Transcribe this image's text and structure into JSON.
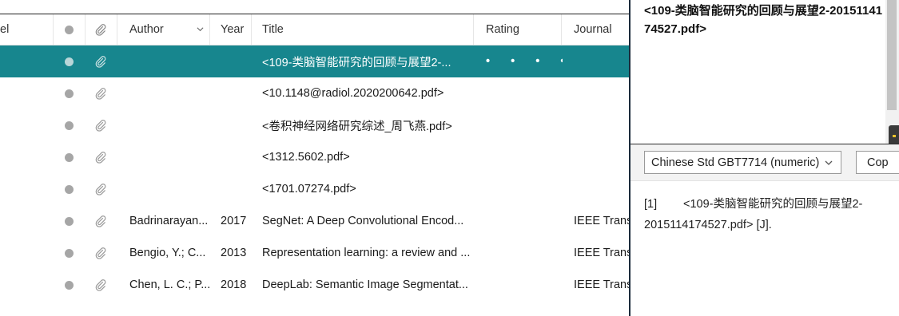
{
  "table": {
    "headers": {
      "label": "el",
      "author": "Author",
      "year": "Year",
      "title": "Title",
      "rating": "Rating",
      "journal": "Journal"
    },
    "rows": [
      {
        "author": "",
        "year": "",
        "title": "<109-类脑智能研究的回顾与展望2-...",
        "rating": "• • • • •",
        "journal": "",
        "selected": true
      },
      {
        "author": "",
        "year": "",
        "title": "<10.1148@radiol.2020200642.pdf>",
        "rating": "",
        "journal": ""
      },
      {
        "author": "",
        "year": "",
        "title": "<卷积神经网络研究综述_周飞燕.pdf>",
        "rating": "",
        "journal": ""
      },
      {
        "author": "",
        "year": "",
        "title": "<1312.5602.pdf>",
        "rating": "",
        "journal": ""
      },
      {
        "author": "",
        "year": "",
        "title": "<1701.07274.pdf>",
        "rating": "",
        "journal": ""
      },
      {
        "author": "Badrinarayan...",
        "year": "2017",
        "title": "SegNet: A Deep Convolutional Encod...",
        "rating": "",
        "journal": "IEEE Trans"
      },
      {
        "author": "Bengio, Y.; C...",
        "year": "2013",
        "title": "Representation learning: a review and ...",
        "rating": "",
        "journal": "IEEE Trans"
      },
      {
        "author": "Chen, L. C.; P...",
        "year": "2018",
        "title": "DeepLab: Semantic Image Segmentat...",
        "rating": "",
        "journal": "IEEE Trans"
      }
    ]
  },
  "preview": {
    "title": "<109-类脑智能研究的回顾与展望2-2015114174527.pdf>"
  },
  "citation_style": {
    "selected": "Chinese Std GBT7714 (numeric)",
    "copy_label": "Cop"
  },
  "citation": {
    "number": "[1]",
    "text": "<109-类脑智能研究的回顾与展望2-2015114174527.pdf> [J]."
  },
  "colors": {
    "selected_row": "#17868e",
    "dot": "#a6a6a6"
  },
  "icons": {
    "read_status": "dot-icon",
    "attachment": "paperclip-icon",
    "sort": "chevron-down-icon"
  }
}
